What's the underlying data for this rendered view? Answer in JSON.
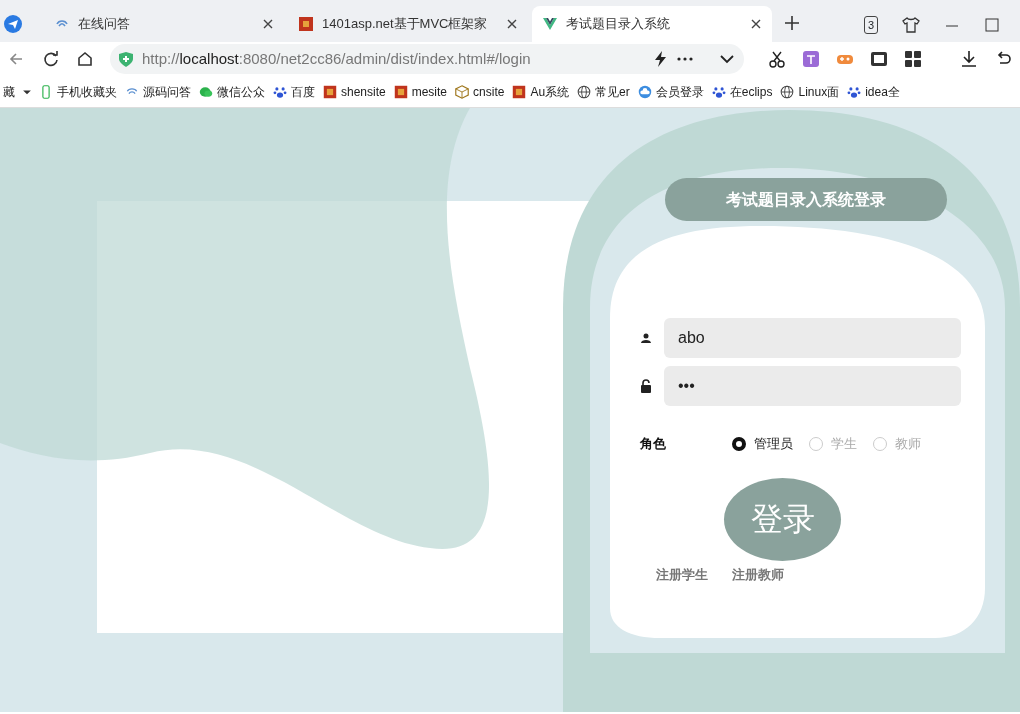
{
  "browser": {
    "tabs": [
      {
        "title": "在线问答",
        "selected": false
      },
      {
        "title": "1401asp.net基于MVC框架家",
        "selected": false
      },
      {
        "title": "考试题目录入系统",
        "selected": true
      }
    ],
    "tab_count": "3",
    "url": {
      "scheme": "http://",
      "host": "localhost",
      "path": ":8080/net2cc86/admin/dist/index.html#/login"
    },
    "bookmarks": [
      {
        "label": "藏",
        "kind": "folder"
      },
      {
        "label": "手机收藏夹",
        "kind": "phone"
      },
      {
        "label": "源码问答",
        "kind": "wave"
      },
      {
        "label": "微信公众",
        "kind": "chat"
      },
      {
        "label": "百度",
        "kind": "paw"
      },
      {
        "label": "shensite",
        "kind": "square"
      },
      {
        "label": "mesite",
        "kind": "square"
      },
      {
        "label": "cnsite",
        "kind": "cube"
      },
      {
        "label": "Au系统",
        "kind": "square"
      },
      {
        "label": "常见er",
        "kind": "globe"
      },
      {
        "label": "会员登录",
        "kind": "cloud"
      },
      {
        "label": "在eclips",
        "kind": "paw"
      },
      {
        "label": "Linux面",
        "kind": "globe"
      },
      {
        "label": "idea全",
        "kind": "paw"
      }
    ]
  },
  "login": {
    "title": "考试题目录入系统登录",
    "username": "abo",
    "password": "•••",
    "role_label": "角色",
    "roles": [
      {
        "label": "管理员",
        "selected": true
      },
      {
        "label": "学生",
        "selected": false
      },
      {
        "label": "教师",
        "selected": false
      }
    ],
    "submit": "登录",
    "links": [
      "注册学生",
      "注册教师"
    ]
  }
}
